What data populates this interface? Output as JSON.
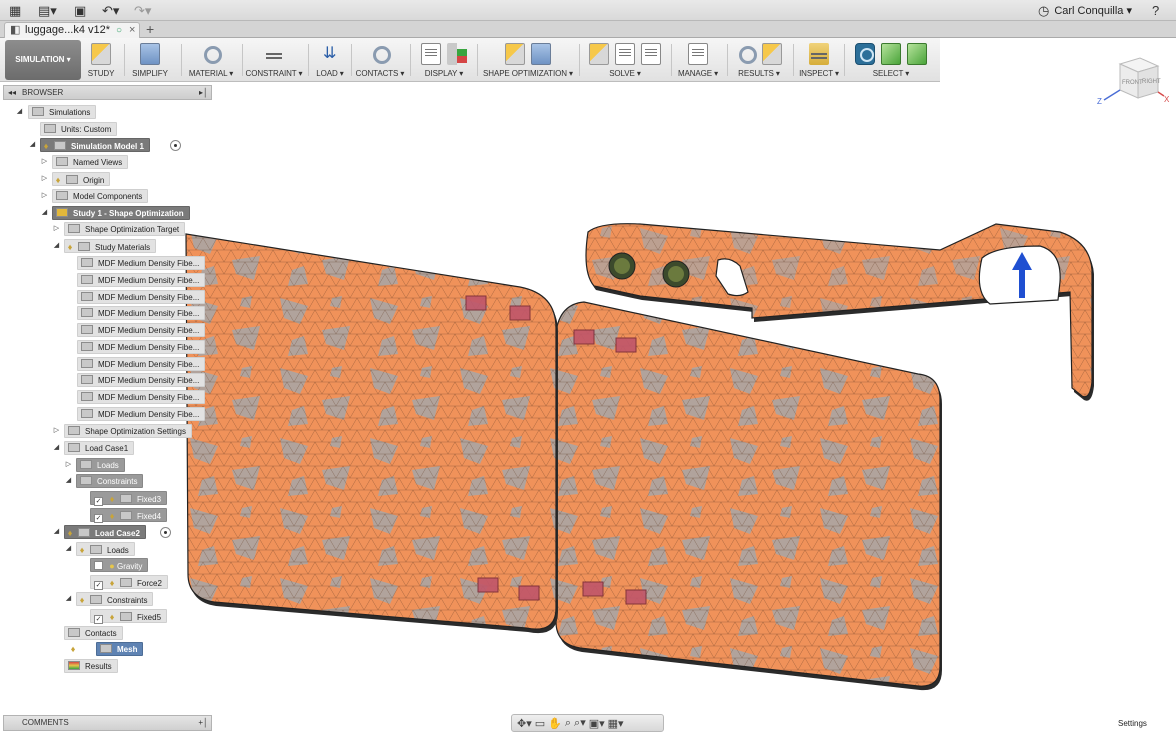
{
  "app": {
    "user": "Carl Conquilla ▾"
  },
  "tab": {
    "title": "luggage...k4 v12*",
    "state": "○",
    "close": "×",
    "new": "+"
  },
  "toolbar": {
    "workspace": "SIMULATION ▾",
    "groups": [
      {
        "label": "STUDY"
      },
      {
        "label": "SIMPLIFY"
      },
      {
        "label": "MATERIAL ▾"
      },
      {
        "label": "CONSTRAINT ▾"
      },
      {
        "label": "LOAD ▾"
      },
      {
        "label": "CONTACTS ▾"
      },
      {
        "label": "DISPLAY ▾"
      },
      {
        "label": "SHAPE OPTIMIZATION ▾"
      },
      {
        "label": "SOLVE ▾"
      },
      {
        "label": "MANAGE ▾"
      },
      {
        "label": "RESULTS ▾"
      },
      {
        "label": "INSPECT ▾"
      },
      {
        "label": "SELECT ▾"
      }
    ]
  },
  "browser": {
    "title": "BROWSER",
    "nodes": {
      "simulations": "Simulations",
      "units": "Units: Custom",
      "model": "Simulation Model 1",
      "named_views": "Named Views",
      "origin": "Origin",
      "model_components": "Model Components",
      "study": "Study 1 - Shape Optimization",
      "target": "Shape Optimization Target",
      "materials": "Study Materials",
      "material_items": [
        "MDF Medium Density Fibe...",
        "MDF Medium Density Fibe...",
        "MDF Medium Density Fibe...",
        "MDF Medium Density Fibe...",
        "MDF Medium Density Fibe...",
        "MDF Medium Density Fibe...",
        "MDF Medium Density Fibe...",
        "MDF Medium Density Fibe...",
        "MDF Medium Density Fibe...",
        "MDF Medium Density Fibe..."
      ],
      "settings": "Shape Optimization Settings",
      "lc1": "Load Case1",
      "lc1_loads": "Loads",
      "lc1_constraints": "Constraints",
      "fixed3": "Fixed3",
      "fixed4": "Fixed4",
      "lc2": "Load Case2",
      "lc2_loads": "Loads",
      "gravity": "Gravity",
      "force2": "Force2",
      "lc2_constraints": "Constraints",
      "fixed5": "Fixed5",
      "contacts": "Contacts",
      "mesh": "Mesh",
      "results": "Results"
    }
  },
  "viewcube": {
    "front": "FRONT",
    "right": "RIGHT",
    "z": "Z",
    "x": "X"
  },
  "bottom": {
    "comments": "COMMENTS",
    "settings": "Settings"
  },
  "colors": {
    "mesh_orange": "#f0925a",
    "mesh_gray": "#a6a6a8",
    "arrow_blue": "#1f4fd1",
    "select_blue": "#2c6f99"
  }
}
